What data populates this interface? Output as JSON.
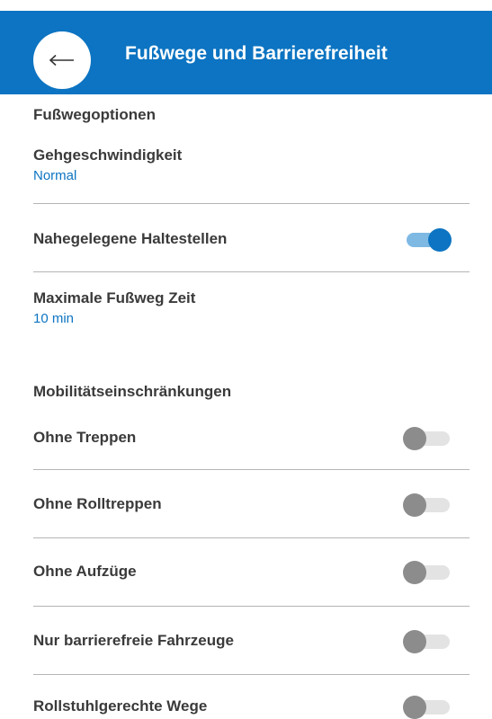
{
  "header": {
    "title": "Fußwege und Barrierefreiheit",
    "back_icon": "arrow-left-icon",
    "background_color": "#0c74c2"
  },
  "walking_options": {
    "heading": "Fußwegoptionen",
    "speed": {
      "label": "Gehgeschwindigkeit",
      "value": "Normal"
    },
    "nearby_stops": {
      "label": "Nahegelegene Haltestellen",
      "enabled": true
    },
    "max_walk_time": {
      "label": "Maximale Fußweg Zeit",
      "value": "10 min"
    }
  },
  "mobility": {
    "heading": "Mobilitätseinschränkungen",
    "items": [
      {
        "label": "Ohne Treppen",
        "enabled": false
      },
      {
        "label": "Ohne Rolltreppen",
        "enabled": false
      },
      {
        "label": "Ohne Aufzüge",
        "enabled": false
      },
      {
        "label": "Nur barrierefreie Fahrzeuge",
        "enabled": false
      },
      {
        "label": "Rollstuhlgerechte Wege",
        "enabled": false
      }
    ]
  },
  "colors": {
    "accent": "#0c74c2",
    "text": "#3a3a3a",
    "divider": "#b5b5b5"
  }
}
